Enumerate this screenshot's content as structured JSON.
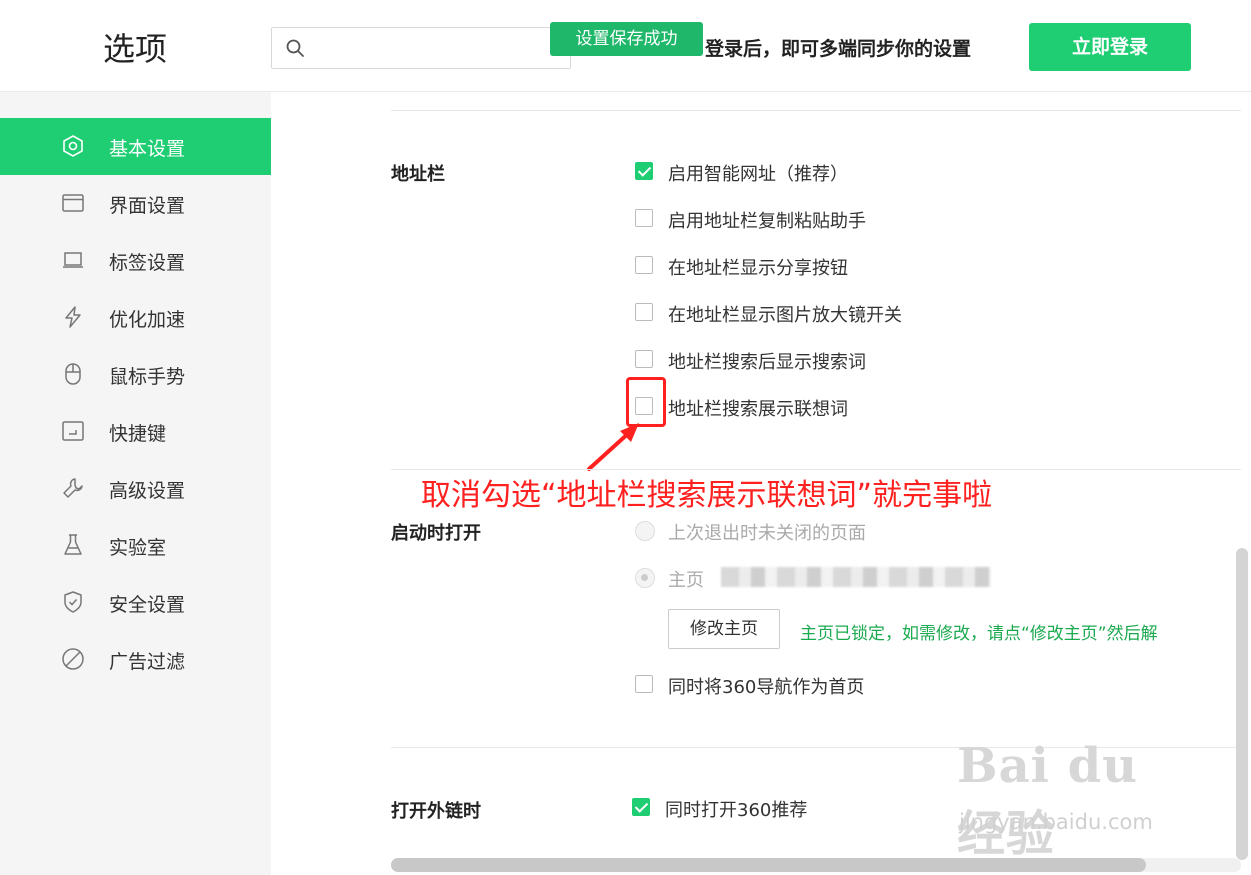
{
  "header": {
    "title": "选项",
    "search_placeholder": "",
    "toast": "设置保存成功",
    "sync_message": "登录后，即可多端同步你的设置",
    "login_button": "立即登录"
  },
  "sidebar": {
    "items": [
      {
        "label": "基本设置",
        "icon": "settings-gear-icon",
        "active": true
      },
      {
        "label": "界面设置",
        "icon": "window-icon",
        "active": false
      },
      {
        "label": "标签设置",
        "icon": "tab-icon",
        "active": false
      },
      {
        "label": "优化加速",
        "icon": "lightning-icon",
        "active": false
      },
      {
        "label": "鼠标手势",
        "icon": "mouse-icon",
        "active": false
      },
      {
        "label": "快捷键",
        "icon": "keyboard-icon",
        "active": false
      },
      {
        "label": "高级设置",
        "icon": "wrench-icon",
        "active": false
      },
      {
        "label": "实验室",
        "icon": "flask-icon",
        "active": false
      },
      {
        "label": "安全设置",
        "icon": "shield-icon",
        "active": false
      },
      {
        "label": "广告过滤",
        "icon": "block-icon",
        "active": false
      }
    ]
  },
  "address_bar": {
    "title": "地址栏",
    "options": [
      {
        "label": "启用智能网址（推荐）",
        "checked": true
      },
      {
        "label": "启用地址栏复制粘贴助手",
        "checked": false
      },
      {
        "label": "在地址栏显示分享按钮",
        "checked": false
      },
      {
        "label": "在地址栏显示图片放大镜开关",
        "checked": false
      },
      {
        "label": "地址栏搜索后显示搜索词",
        "checked": false
      },
      {
        "label": "地址栏搜索展示联想词",
        "checked": false
      }
    ]
  },
  "annotation": {
    "text": "取消勾选“地址栏搜索展示联想词”就完事啦",
    "color": "#ff2020"
  },
  "startup": {
    "title": "启动时打开",
    "radio_last_session": "上次退出时未关闭的页面",
    "radio_homepage": "主页",
    "edit_home_button": "修改主页",
    "locked_message": "主页已锁定，如需修改，请点“修改主页”然后解",
    "nav360_option": "同时将360导航作为首页"
  },
  "external_links": {
    "title": "打开外链时",
    "option": "同时打开360推荐",
    "checked": true
  },
  "watermark": {
    "brand": "Bai du 经验",
    "url": "jingyan.baidu.com"
  },
  "colors": {
    "accent": "#1fcd73",
    "toast": "#1fb76a",
    "locked_message": "#1ba94f"
  }
}
